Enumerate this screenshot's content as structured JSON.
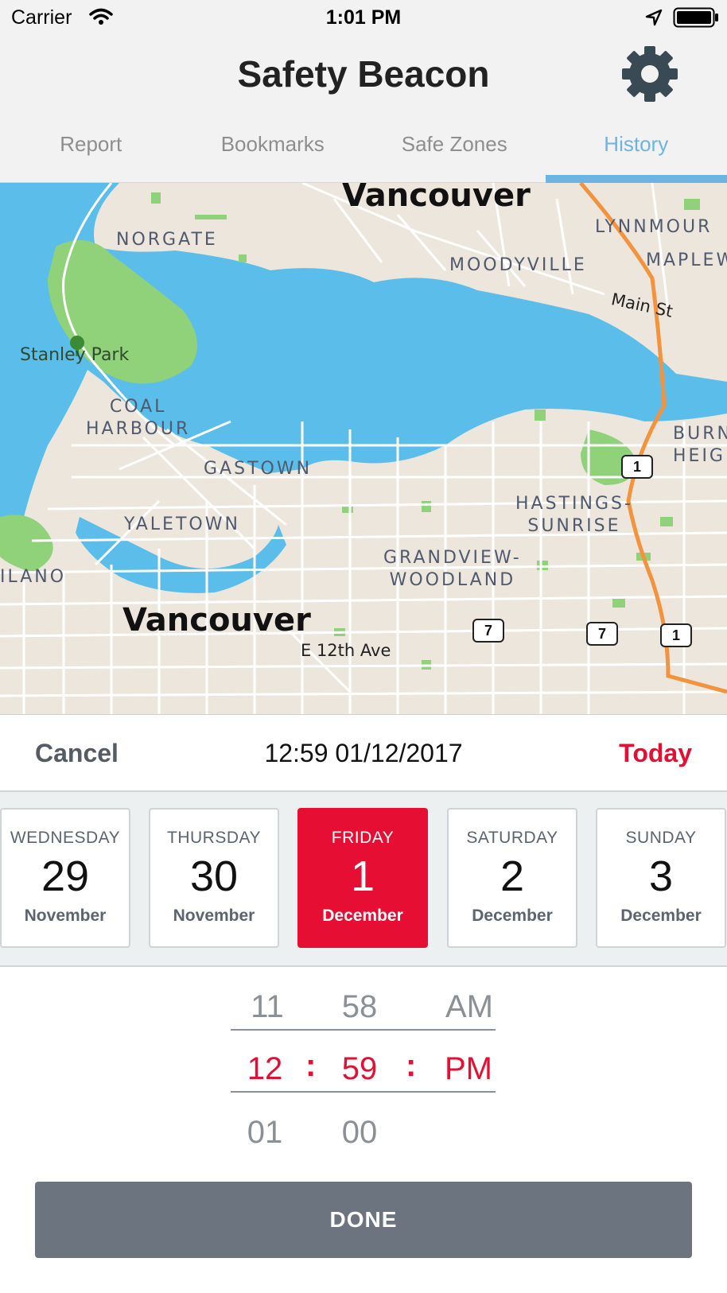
{
  "status_bar": {
    "carrier": "Carrier",
    "time": "1:01 PM"
  },
  "header": {
    "title": "Safety Beacon",
    "tabs": [
      {
        "label": "Report",
        "active": false
      },
      {
        "label": "Bookmarks",
        "active": false
      },
      {
        "label": "Safe Zones",
        "active": false
      },
      {
        "label": "History",
        "active": true
      }
    ],
    "accent_color": "#6cb4e4"
  },
  "map": {
    "labels": {
      "vancouver_north": "Vancouver",
      "vancouver_south": "Vancouver",
      "norgate": "NORGATE",
      "moodyville": "MOODYVILLE",
      "lynnmour": "LYNNMOUR",
      "maplew": "MAPLEW",
      "main_st": "Main St",
      "stanley_park": "Stanley Park",
      "coal_harbour": "COAL\nHARBOUR",
      "gastown": "GASTOWN",
      "burn": "BURN\nHEIG",
      "hastings": "HASTINGS-\nSUNRISE",
      "yaletown": "YALETOWN",
      "grandview": "GRANDVIEW-\nWOODLAND",
      "ilano": "ILANO",
      "e12th": "E 12th Ave"
    },
    "shields": {
      "hwy1_a": "1",
      "hwy7_a": "7",
      "hwy7_b": "7",
      "hwy1_b": "1"
    }
  },
  "date_bar": {
    "cancel_label": "Cancel",
    "current_value": "12:59 01/12/2017",
    "today_label": "Today",
    "highlight_color": "#e60e32"
  },
  "days": [
    {
      "dow": "WEDNESDAY",
      "num": "29",
      "month": "November",
      "selected": false
    },
    {
      "dow": "THURSDAY",
      "num": "30",
      "month": "November",
      "selected": false
    },
    {
      "dow": "FRIDAY",
      "num": "1",
      "month": "December",
      "selected": true
    },
    {
      "dow": "SATURDAY",
      "num": "2",
      "month": "December",
      "selected": false
    },
    {
      "dow": "SUNDAY",
      "num": "3",
      "month": "December",
      "selected": false
    }
  ],
  "time_picker": {
    "hours": {
      "prev": "11",
      "selected": "12",
      "next": "01"
    },
    "minutes": {
      "prev": "58",
      "selected": "59",
      "next": "00"
    },
    "period": {
      "prev": "AM",
      "selected": "PM"
    },
    "separator": ":"
  },
  "done_label": "DONE"
}
